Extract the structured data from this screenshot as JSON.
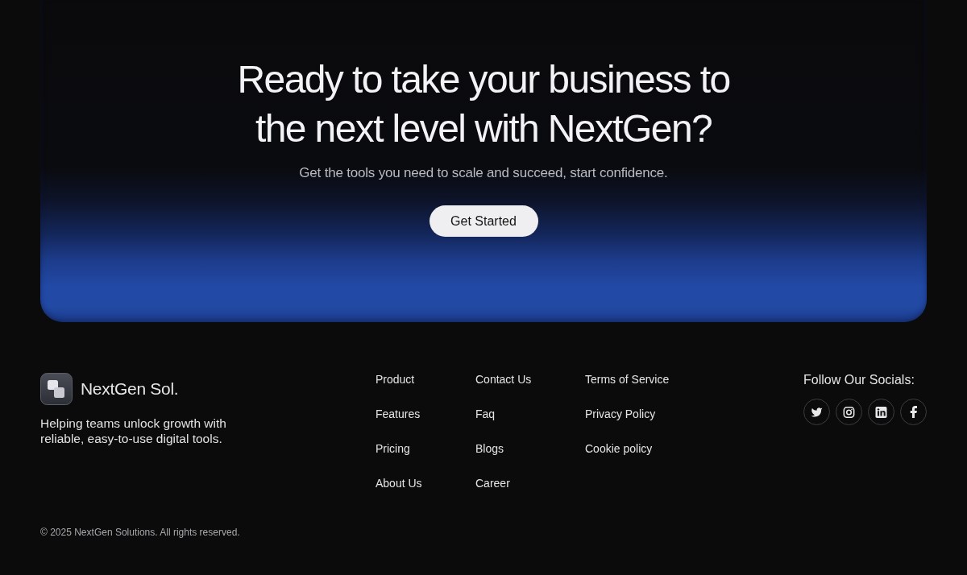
{
  "hero": {
    "heading": "Ready to take your business to the next level with NextGen?",
    "subtitle": "Get the tools you need to scale and succeed, start confidence.",
    "button": "Get Started"
  },
  "footer": {
    "brand": {
      "name": "NextGen Sol.",
      "tagline": "Helping teams unlock growth with reliable, easy-to-use digital tools."
    },
    "link_columns": [
      [
        "Product",
        "Features",
        "Pricing",
        "About Us"
      ],
      [
        "Contact Us",
        "Faq",
        "Blogs",
        "Career"
      ],
      [
        "Terms of Service",
        "Privacy Policy",
        "Cookie policy"
      ]
    ],
    "socials": {
      "title": "Follow Our Socials:"
    },
    "copyright": "© 2025 NextGen Solutions. All rights reserved."
  }
}
